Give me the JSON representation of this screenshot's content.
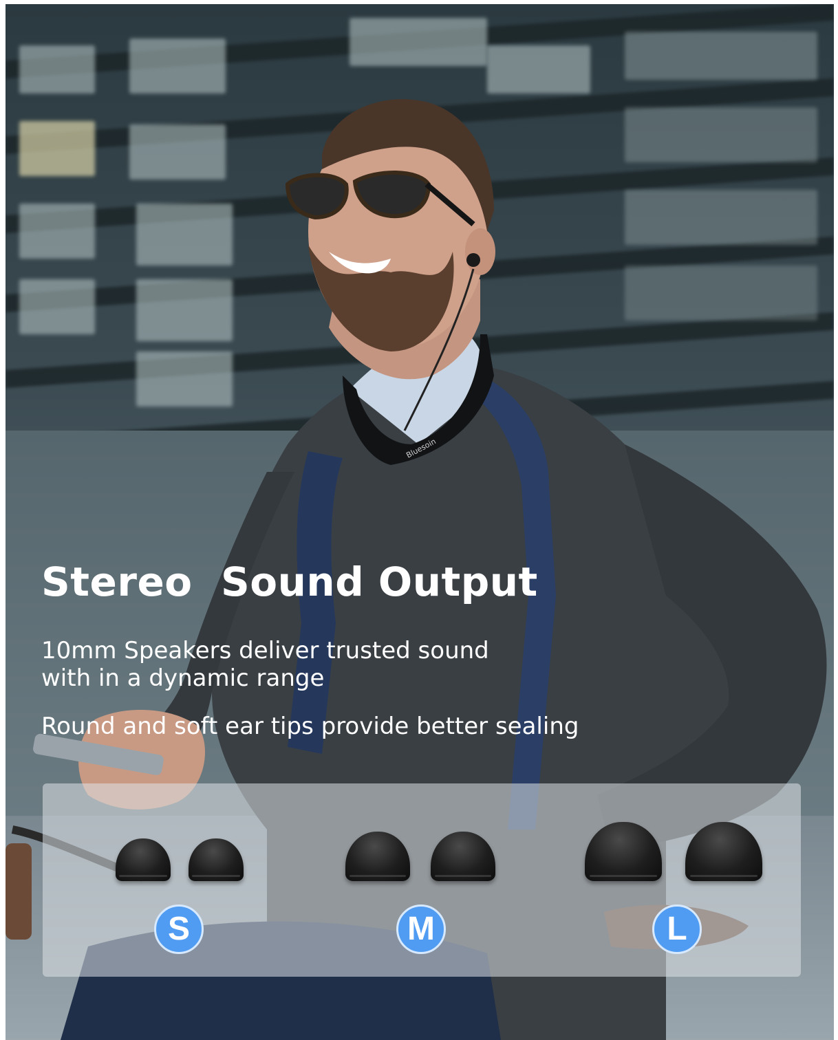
{
  "headline": "Stereo  Sound Output",
  "description_line1": "10mm Speakers deliver trusted sound",
  "description_line2": "with in a dynamic range",
  "description_line3": "Round and soft ear tips provide better sealing",
  "neckband_brand": "Bluesoin",
  "ear_tip_sizes": [
    {
      "label": "S"
    },
    {
      "label": "M"
    },
    {
      "label": "L"
    }
  ],
  "colors": {
    "badge_blue": "#4f9cf2",
    "text": "#ffffff",
    "panel": "#dce1e6"
  }
}
